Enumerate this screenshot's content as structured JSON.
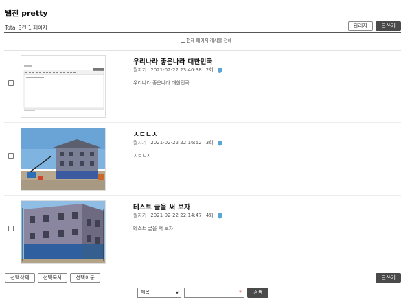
{
  "board": {
    "title": "웹진 pretty",
    "total_text": "Total 3건 1 페이지",
    "admin_label": "관리자",
    "write_label": "글쓰기",
    "select_all_label": "현재 페이지 게시물 전체"
  },
  "posts": [
    {
      "subject": "우리나라 좋은나라 대한민국",
      "author": "월지기",
      "datetime": "2021-02-22 23:40:38",
      "hits": "2회",
      "summary": "우리나라 좋은나라 대한민국",
      "thumb": "editor-screenshot"
    },
    {
      "subject": "ㅅㄷㄴㅅ",
      "author": "월지기",
      "datetime": "2021-02-22 22:16:52",
      "hits": "3회",
      "summary": "ㅅㄷㄴㅅ",
      "thumb": "building-crane-photo"
    },
    {
      "subject": "테스트 글을 써 보자",
      "author": "월지기",
      "datetime": "2021-02-22 22:14:47",
      "hits": "4회",
      "summary": "테스트 글을 써 보자",
      "thumb": "building-construction-photo"
    }
  ],
  "bottom": {
    "delete_label": "선택삭제",
    "copy_label": "선택복사",
    "move_label": "선택이동",
    "write_label": "글쓰기"
  },
  "search": {
    "field_selected": "제목",
    "button_label": "검색",
    "required_mark": "*"
  },
  "colors": {
    "dark_button": "#4a4a4a",
    "comment_icon": "#5aa6d6",
    "required": "#e33333"
  }
}
